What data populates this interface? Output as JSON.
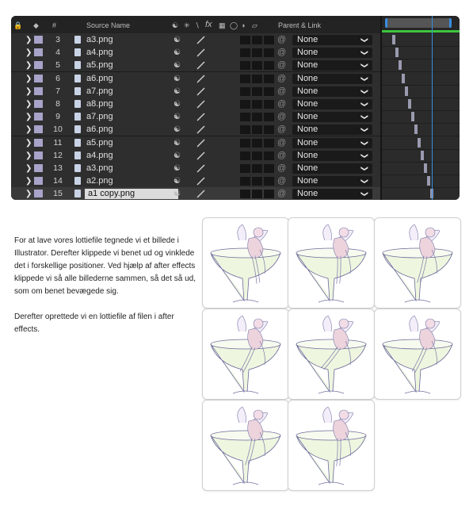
{
  "ae_panel": {
    "header": {
      "num_label": "#",
      "source_name_label": "Source Name",
      "fx_label": "fx",
      "parent_link_label": "Parent & Link"
    },
    "layers": [
      {
        "num": "3",
        "name": "a3.png",
        "parent": "None"
      },
      {
        "num": "4",
        "name": "a4.png",
        "parent": "None"
      },
      {
        "num": "5",
        "name": "a5.png",
        "parent": "None"
      },
      {
        "num": "6",
        "name": "a6.png",
        "parent": "None"
      },
      {
        "num": "7",
        "name": "a7.png",
        "parent": "None"
      },
      {
        "num": "8",
        "name": "a8.png",
        "parent": "None"
      },
      {
        "num": "9",
        "name": "a7.png",
        "parent": "None"
      },
      {
        "num": "10",
        "name": "a6.png",
        "parent": "None"
      },
      {
        "num": "11",
        "name": "a5.png",
        "parent": "None"
      },
      {
        "num": "12",
        "name": "a4.png",
        "parent": "None"
      },
      {
        "num": "13",
        "name": "a3.png",
        "parent": "None"
      },
      {
        "num": "14",
        "name": "a2.png",
        "parent": "None"
      },
      {
        "num": "15",
        "name": "a1 copy.png",
        "parent": "None"
      }
    ],
    "colors": {
      "label_swatch": "#a7a3c9",
      "playhead": "#3a8dde",
      "work_area": "#3ec43e"
    }
  },
  "description": {
    "paragraph1": "For at lave vores lottiefile tegnede vi et billede i Illustrator. Derefter klippede vi benet ud og vinklede det i forskellige positioner. Ved hjælp af after effects klippede vi så alle billederne sammen, så det så ud, som om benet bevægede sig.",
    "paragraph2": "Derefter oprettede vi en lottiefile af filen i after effects."
  },
  "frames": {
    "count": 8,
    "subject": "fairy sitting on a cocktail glass"
  }
}
